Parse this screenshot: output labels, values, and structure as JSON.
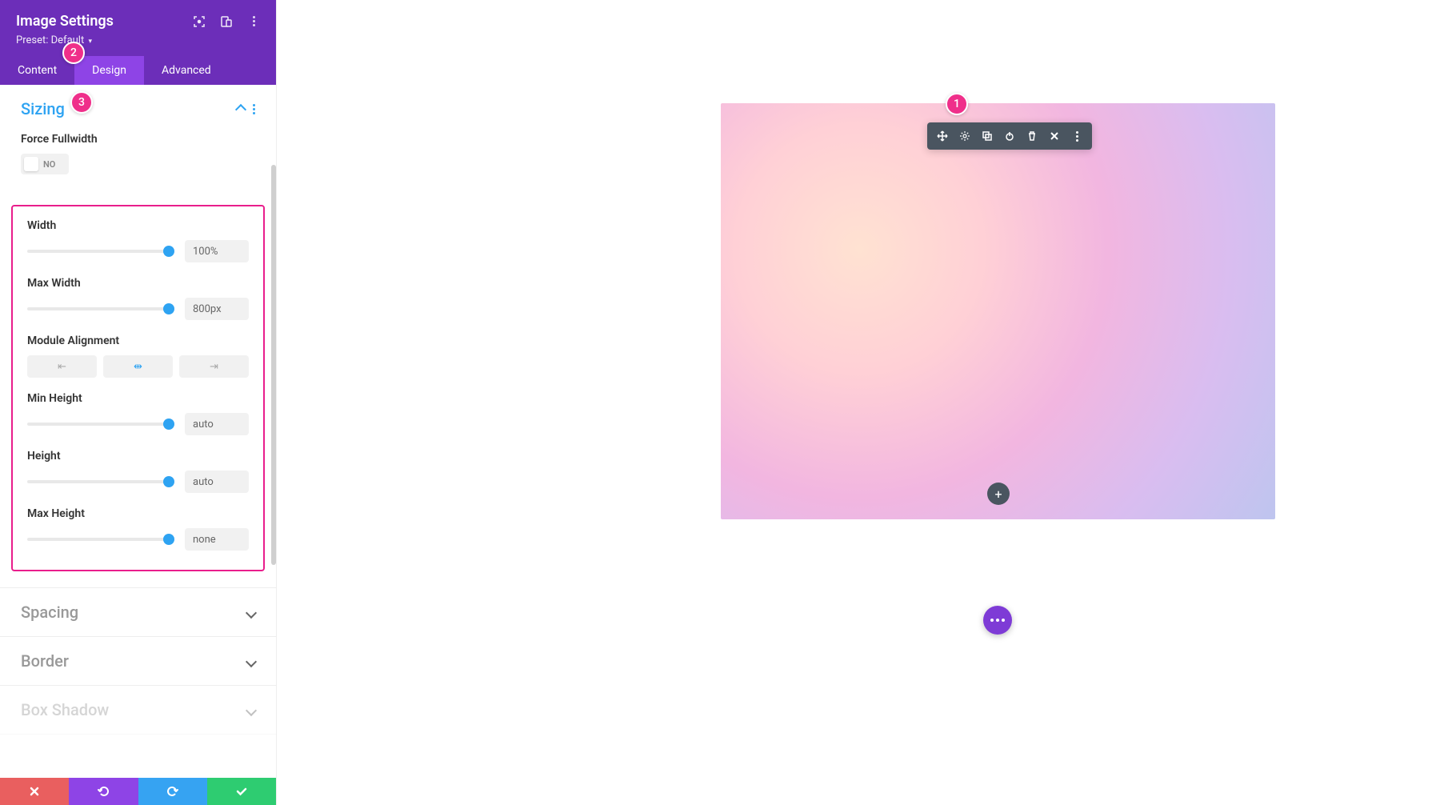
{
  "header": {
    "title": "Image Settings",
    "preset_label": "Preset:",
    "preset_value": "Default"
  },
  "tabs": {
    "content": "Content",
    "design": "Design",
    "advanced": "Advanced"
  },
  "sections": {
    "sizing": {
      "title": "Sizing"
    },
    "spacing": {
      "title": "Spacing"
    },
    "border": {
      "title": "Border"
    },
    "box_shadow": {
      "title": "Box Shadow"
    }
  },
  "controls": {
    "force_fullwidth": {
      "label": "Force Fullwidth",
      "value": "NO"
    },
    "width": {
      "label": "Width",
      "value": "100%"
    },
    "max_width": {
      "label": "Max Width",
      "value": "800px"
    },
    "module_alignment": {
      "label": "Module Alignment"
    },
    "min_height": {
      "label": "Min Height",
      "value": "auto"
    },
    "height": {
      "label": "Height",
      "value": "auto"
    },
    "max_height": {
      "label": "Max Height",
      "value": "none"
    }
  },
  "badges": {
    "b1": "1",
    "b2": "2",
    "b3": "3"
  },
  "canvas": {
    "add": "+"
  }
}
